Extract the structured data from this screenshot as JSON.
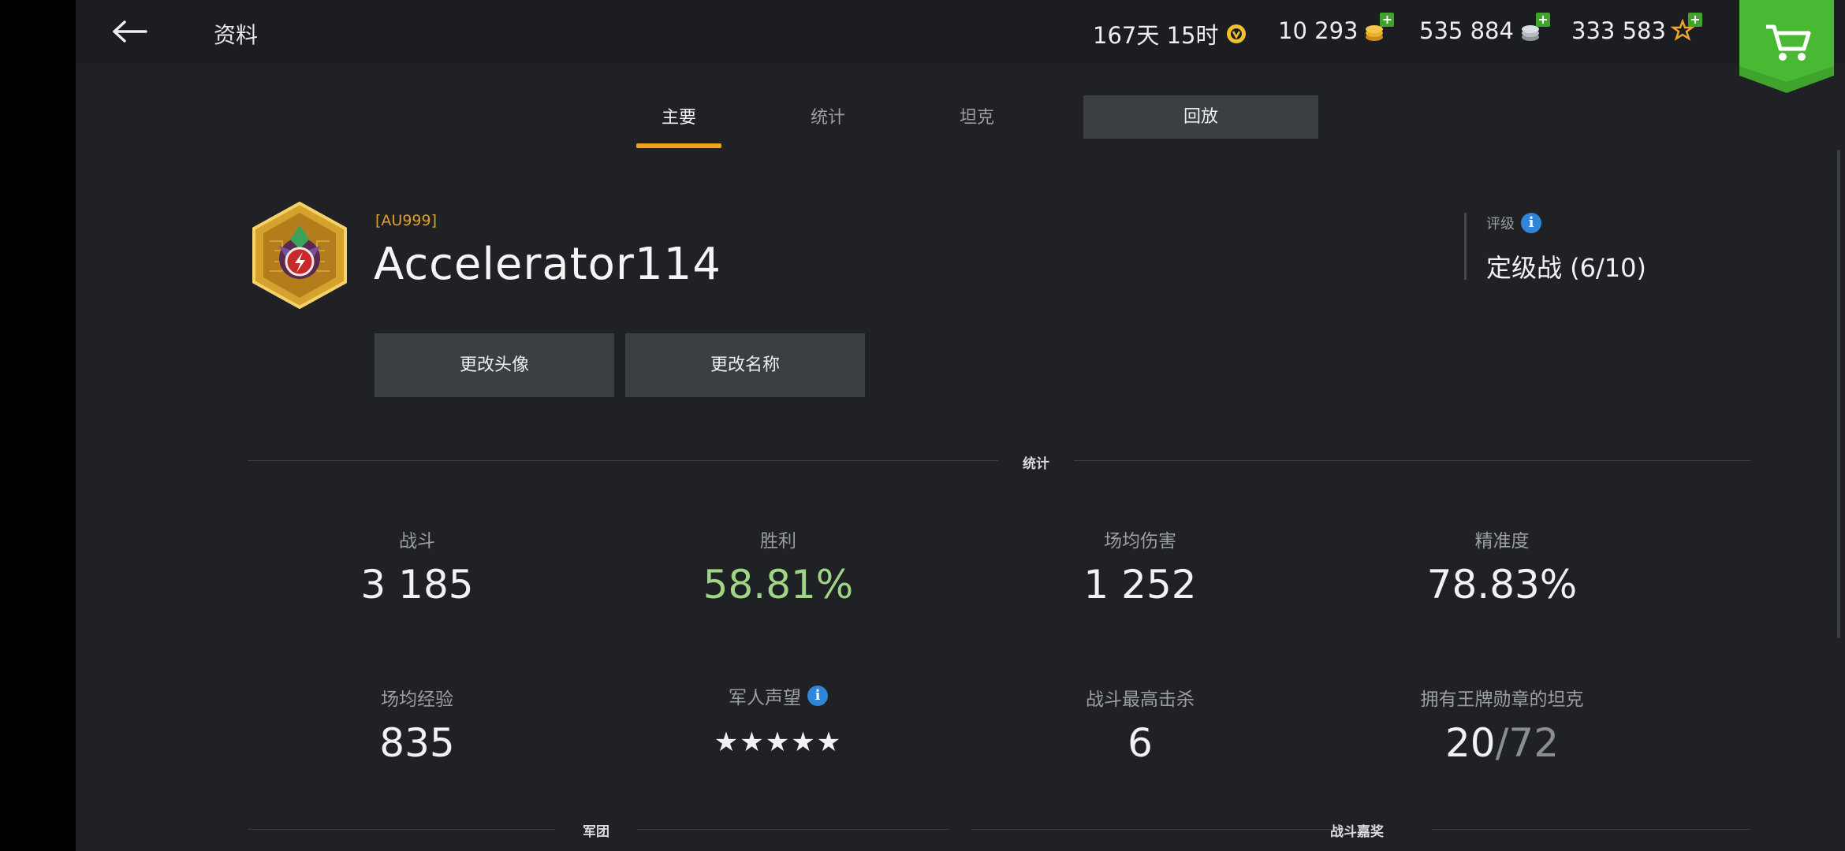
{
  "header": {
    "title": "资料",
    "premium_time": "167天 15时",
    "gold": "10 293",
    "credits": "535 884",
    "free_xp": "333 583"
  },
  "tabs": [
    {
      "label": "主要",
      "active": true
    },
    {
      "label": "统计",
      "active": false
    },
    {
      "label": "坦克",
      "active": false
    }
  ],
  "replay_label": "回放",
  "profile": {
    "clan_tag": "[AU999]",
    "name": "Accelerator114",
    "change_avatar_label": "更改头像",
    "change_name_label": "更改名称"
  },
  "rating": {
    "label": "评级",
    "value": "定级战 (6/10)"
  },
  "sections": {
    "stats": "统计",
    "clan": "军团",
    "awards": "战斗嘉奖"
  },
  "stats": {
    "battles_label": "战斗",
    "battles": "3 185",
    "wins_label": "胜利",
    "wins": "58.81%",
    "avg_damage_label": "场均伤害",
    "avg_damage": "1 252",
    "accuracy_label": "精准度",
    "accuracy": "78.83%",
    "avg_xp_label": "场均经验",
    "avg_xp": "835",
    "reputation_label": "军人声望",
    "reputation_stars": "★★★★★",
    "max_kills_label": "战斗最高击杀",
    "max_kills": "6",
    "ace_tanks_label": "拥有王牌勋章的坦克",
    "ace_tanks_count": "20",
    "ace_tanks_total": "/72"
  },
  "colors": {
    "accent": "#f3a21d",
    "win_green": "#9fd585",
    "shop_green": "#3ea42b",
    "info_blue": "#2f86d9"
  }
}
